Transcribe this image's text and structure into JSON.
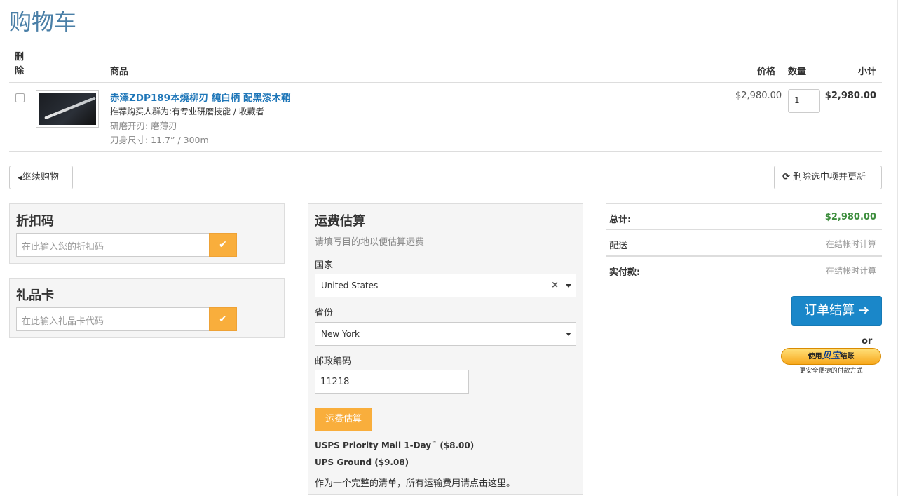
{
  "page": {
    "title": "购物车"
  },
  "table": {
    "headers": {
      "delete": "删除",
      "product": "商品",
      "price": "价格",
      "qty": "数量",
      "subtotal": "小计"
    },
    "rows": [
      {
        "name": "赤澤ZDP189本燒柳刃 純白柄 配黑漆木鞘",
        "audience": "推荐购买人群为:有专业研磨技能 / 收藏者",
        "sharpen": "研磨开刃: 磨薄刃",
        "size": "刀身尺寸: 11.7” / 300m",
        "price": "$2,980.00",
        "qty": "1",
        "subtotal": "$2,980.00"
      }
    ]
  },
  "actions": {
    "continue": "继续购物",
    "update": "删除选中项并更新"
  },
  "discount": {
    "title": "折扣码",
    "placeholder": "在此输入您的折扣码"
  },
  "giftcard": {
    "title": "礼品卡",
    "placeholder": "在此输入礼品卡代码"
  },
  "shipping": {
    "title": "运费估算",
    "hint": "请填写目的地以便估算运费",
    "country_label": "国家",
    "country_value": "United States",
    "clear_icon": "×",
    "state_label": "省份",
    "state_value": "New York",
    "zip_label": "邮政编码",
    "zip_value": "11218",
    "estimate_button": "运费估算",
    "rates": [
      {
        "name": "USPS Priority Mail 1-Day",
        "tm": "™",
        "price": "($8.00)"
      },
      {
        "name": "UPS Ground",
        "tm": "",
        "price": "($9.08)"
      }
    ],
    "note": "作为一个完整的清单，所有运输费用请点击这里。"
  },
  "totals": {
    "total_label": "总计:",
    "total_value": "$2,980.00",
    "shipping_label": "配送",
    "shipping_value": "在结帐时计算",
    "payable_label": "实付款:",
    "payable_value": "在结帐时计算"
  },
  "checkout": {
    "button": "订单结算",
    "or": "or",
    "alipay_prefix": "使用",
    "alipay_brand": "贝宝",
    "alipay_suffix": "结账",
    "alipay_sub": "更安全便捷的付款方式"
  },
  "icons": {
    "continue": "caret-left-icon",
    "update": "refresh-icon",
    "ok": "check-icon",
    "checkout": "arrow-right-icon"
  },
  "colors": {
    "primary": "#1a87c9",
    "warning": "#f9ae3c",
    "link": "#1e76b8",
    "title": "#4a7fa7",
    "success": "#3e8e3e"
  }
}
